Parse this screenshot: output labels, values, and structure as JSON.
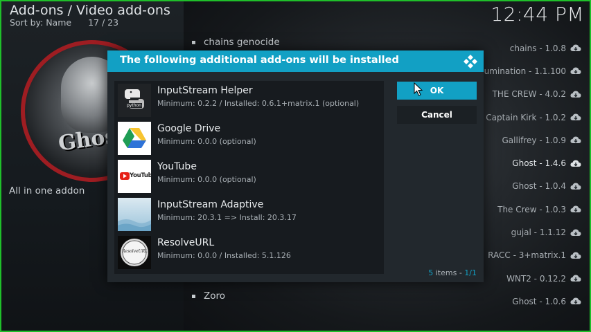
{
  "header": {
    "title": "Add-ons / Video add-ons",
    "sort": "Sort by: Name",
    "position": "17 / 23",
    "clock": "12:44 PM"
  },
  "left_panel": {
    "logo_text": "Ghost",
    "description": "All in one addon"
  },
  "background_list": {
    "top_item": "chains genocide",
    "bottom_item": "Zoro"
  },
  "right_list": [
    {
      "label": "chains - 1.0.8",
      "icon": "cloud-download-icon"
    },
    {
      "label": "Cumination - 1.1.100",
      "icon": "cloud-download-icon"
    },
    {
      "label": "THE CREW - 4.0.2",
      "icon": "cloud-download-icon"
    },
    {
      "label": "Captain Kirk - 1.0.2",
      "icon": "cloud-download-icon"
    },
    {
      "label": "Gallifrey - 1.0.9",
      "icon": "cloud-download-icon"
    },
    {
      "label": "Ghost - 1.4.6",
      "icon": "cloud-download-icon"
    },
    {
      "label": "Ghost - 1.0.4",
      "icon": "cloud-download-icon"
    },
    {
      "label": "The Crew - 1.0.3",
      "icon": "cloud-download-icon"
    },
    {
      "label": "gujal - 1.1.12",
      "icon": "cloud-download-icon"
    },
    {
      "label": "RACC - 3+matrix.1",
      "icon": "cloud-download-icon"
    },
    {
      "label": "WNT2 - 0.12.2",
      "icon": "cloud-download-icon"
    },
    {
      "label": "Ghost - 1.0.6",
      "icon": "cloud-download-icon"
    }
  ],
  "dialog": {
    "title": "The following additional add-ons will be installed",
    "ok_label": "OK",
    "cancel_label": "Cancel",
    "items_count": "5",
    "items_word": " items - ",
    "page": "1/1",
    "addons": [
      {
        "name": "InputStream Helper",
        "detail": "Minimum: 0.2.2 / Installed: 0.6.1+matrix.1 (optional)",
        "icon": "python-icon",
        "icon_text": "python"
      },
      {
        "name": "Google Drive",
        "detail": "Minimum: 0.0.0 (optional)",
        "icon": "google-drive-icon"
      },
      {
        "name": "YouTube",
        "detail": "Minimum: 0.0.0 (optional)",
        "icon": "youtube-icon",
        "icon_text": "YouTube"
      },
      {
        "name": "InputStream Adaptive",
        "detail": "Minimum: 20.3.1 => Install: 20.3.17",
        "icon": "inputstream-adaptive-icon"
      },
      {
        "name": "ResolveURL",
        "detail": "Minimum: 0.0.0 / Installed: 5.1.126",
        "icon": "resolveurl-icon",
        "icon_text": "ResolveURL"
      }
    ]
  },
  "colors": {
    "accent": "#12a0c4",
    "dialog_bg": "#22282d",
    "frame": "#1fbf2a"
  }
}
